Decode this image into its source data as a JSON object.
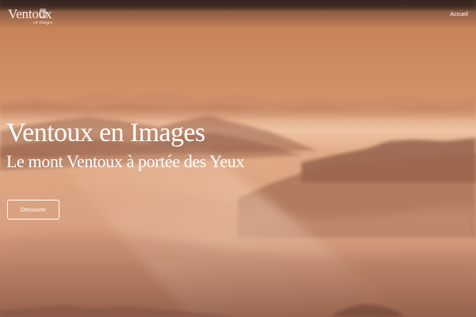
{
  "header": {
    "logo": {
      "wordmark": "Ventoux",
      "tagline": "en images",
      "icon": "camera-icon"
    },
    "nav": {
      "accueil_label": "Accueil"
    }
  },
  "hero": {
    "background": "mountain-ridges-sunset-haze",
    "title": "Ventoux en Images",
    "subtitle": "Le mont Ventoux à portée des Yeux",
    "cta_label": "Découvrir"
  },
  "colors": {
    "sky_top": "#c97f57",
    "haze": "#e8b48e",
    "ridge_dark": "#8a5a44",
    "text": "#ffffff"
  }
}
